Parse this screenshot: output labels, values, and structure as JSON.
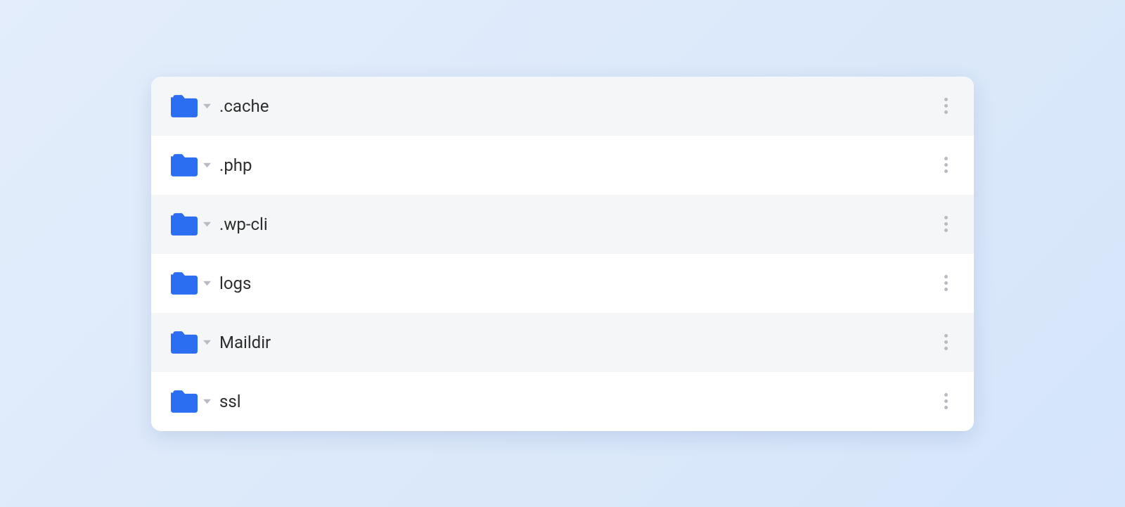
{
  "colors": {
    "folder": "#2b6ef2",
    "caret": "#b8bbc2",
    "kebab_dot": "#b8bbc2"
  },
  "files": [
    {
      "name": ".cache",
      "shaded": true
    },
    {
      "name": ".php",
      "shaded": false
    },
    {
      "name": ".wp-cli",
      "shaded": true
    },
    {
      "name": "logs",
      "shaded": false
    },
    {
      "name": "Maildir",
      "shaded": true
    },
    {
      "name": "ssl",
      "shaded": false
    }
  ]
}
